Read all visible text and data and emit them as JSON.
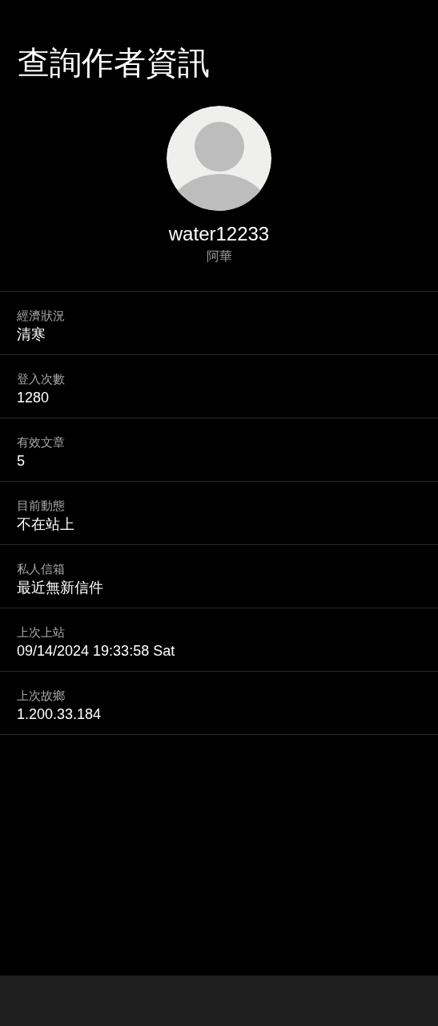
{
  "title": "查詢作者資訊",
  "profile": {
    "username": "water12233",
    "nickname": "阿華"
  },
  "fields": [
    {
      "label": "經濟狀況",
      "value": "清寒"
    },
    {
      "label": "登入次數",
      "value": "1280"
    },
    {
      "label": "有效文章",
      "value": "5"
    },
    {
      "label": "目前動態",
      "value": "不在站上"
    },
    {
      "label": "私人信箱",
      "value": "最近無新信件"
    },
    {
      "label": "上次上站",
      "value": "09/14/2024 19:33:58 Sat"
    },
    {
      "label": "上次故鄉",
      "value": "1.200.33.184"
    }
  ]
}
